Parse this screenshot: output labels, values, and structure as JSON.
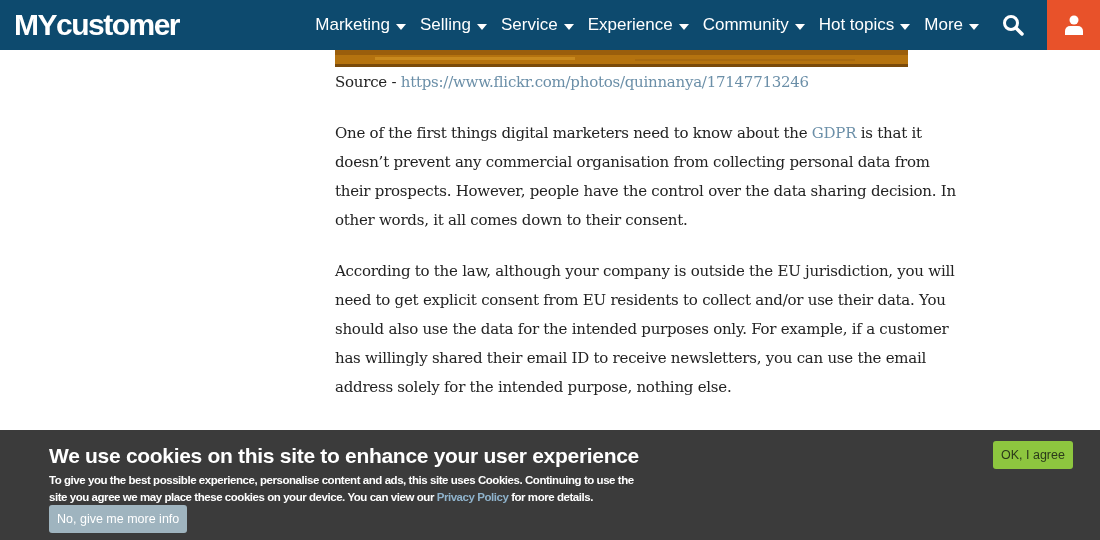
{
  "header": {
    "logo": "MYcustomer",
    "nav": [
      {
        "label": "Marketing"
      },
      {
        "label": "Selling"
      },
      {
        "label": "Service"
      },
      {
        "label": "Experience"
      },
      {
        "label": "Community"
      },
      {
        "label": "Hot topics"
      },
      {
        "label": "More"
      }
    ]
  },
  "article": {
    "source": {
      "label": "Source -",
      "url": "https://www.flickr.com/photos/quinnanya/17147713246"
    },
    "paragraphs": [
      {
        "before": "One of the first things digital marketers need to know about the",
        "link": "GDPR",
        "after": "is that it doesn’t prevent any commercial organisation from collecting personal data from their prospects. However, people have the control over the data sharing decision. In other words, it all comes down to their consent."
      },
      {
        "before": "According to the law, although your company is outside the EU jurisdiction, you will need to get explicit consent from EU residents to collect and/or use their data. You should also use the data for the intended purposes only. For example, if a customer has willingly shared their email ID to receive newsletters, you can use the email address solely for the intended purpose, nothing else."
      }
    ]
  },
  "cookie_banner": {
    "title": "We use cookies on this site to enhance your user experience",
    "text_before": "To give you the best possible experience, personalise content and ads, this site uses Cookies. Continuing to use the site you agree we may place these cookies on your device. You can view our",
    "link": "Privacy Policy",
    "text_after": "for more details.",
    "decline_button": "No, give me more info",
    "accept_button": "OK, I agree"
  }
}
